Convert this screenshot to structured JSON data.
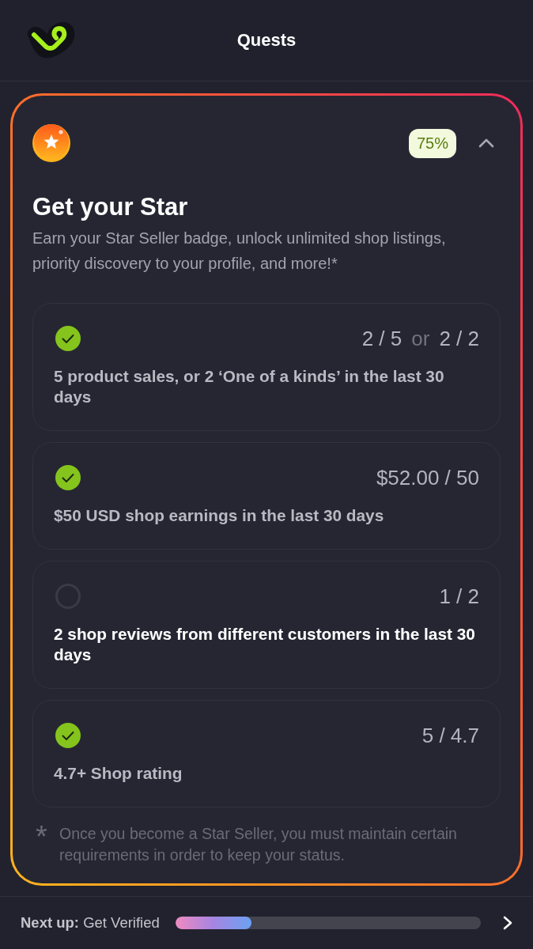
{
  "header": {
    "title": "Quests"
  },
  "quest": {
    "progress": "75%",
    "expanded": true,
    "title": "Get your Star",
    "description": "Earn your Star Seller badge, unlock unlimited shop listings, priority discovery to your profile, and more!*",
    "requirements": [
      {
        "done": true,
        "counts": [
          "2 / 5",
          "2 / 2"
        ],
        "joiner": "or",
        "text": "5 product sales, or 2 ‘One of a kinds’ in the last 30 days"
      },
      {
        "done": true,
        "counts": [
          "$52.00 / 50"
        ],
        "text": "$50 USD shop earnings in the last 30 days"
      },
      {
        "done": false,
        "counts": [
          "1 / 2"
        ],
        "text": "2 shop reviews from different customers in the last 30 days"
      },
      {
        "done": true,
        "counts": [
          "5 / 4.7"
        ],
        "text": "4.7+ Shop rating"
      }
    ],
    "footnote": {
      "mark": "*",
      "text": "Once you become a Star Seller, you must maintain certain requirements in order to keep your status."
    }
  },
  "next_up": {
    "text": "**Next up:** Get Verified",
    "level": 0.25
  }
}
